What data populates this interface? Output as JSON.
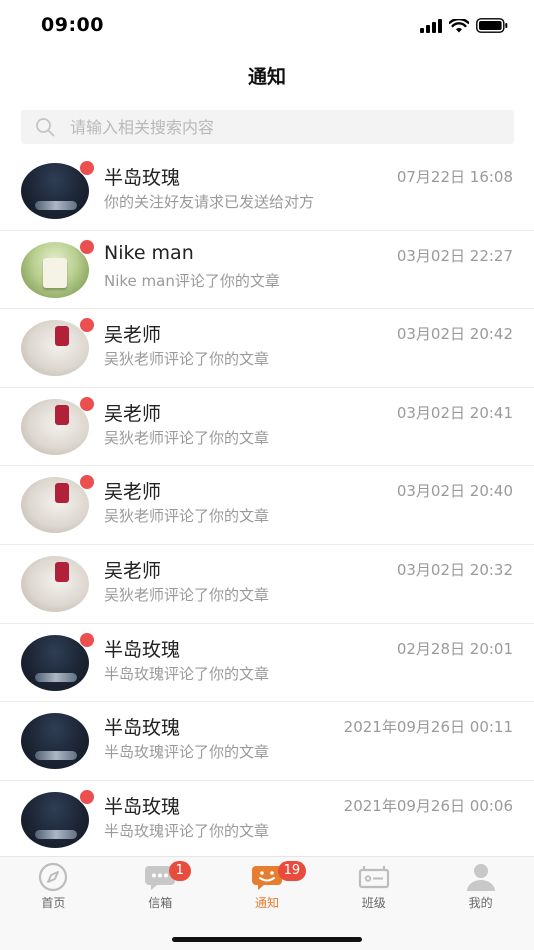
{
  "status_bar": {
    "time": "09:00",
    "icons": [
      "signal-icon",
      "wifi-icon",
      "battery-icon"
    ]
  },
  "header": {
    "title": "通知"
  },
  "search": {
    "placeholder": "请输入相关搜索内容"
  },
  "colors": {
    "accent": "#e67e30",
    "badge": "#e84c3d",
    "unread_dot": "#ec4f4f"
  },
  "notifications": [
    {
      "name": "半岛玫瑰",
      "time": "07月22日 16:08",
      "message": "你的关注好友请求已发送给对方",
      "unread": true,
      "avatar": "night"
    },
    {
      "name": "Nike man",
      "time": "03月02日 22:27",
      "message": "Nike man评论了你的文章",
      "unread": true,
      "avatar": "green"
    },
    {
      "name": "吴老师",
      "time": "03月02日 20:42",
      "message": "吴狄老师评论了你的文章",
      "unread": true,
      "avatar": "flower"
    },
    {
      "name": "吴老师",
      "time": "03月02日 20:41",
      "message": "吴狄老师评论了你的文章",
      "unread": true,
      "avatar": "flower"
    },
    {
      "name": "吴老师",
      "time": "03月02日 20:40",
      "message": "吴狄老师评论了你的文章",
      "unread": true,
      "avatar": "flower"
    },
    {
      "name": "吴老师",
      "time": "03月02日 20:32",
      "message": "吴狄老师评论了你的文章",
      "unread": false,
      "avatar": "flower"
    },
    {
      "name": "半岛玫瑰",
      "time": "02月28日 20:01",
      "message": "半岛玫瑰评论了你的文章",
      "unread": true,
      "avatar": "night"
    },
    {
      "name": "半岛玫瑰",
      "time": "2021年09月26日 00:11",
      "message": "半岛玫瑰评论了你的文章",
      "unread": false,
      "avatar": "night"
    },
    {
      "name": "半岛玫瑰",
      "time": "2021年09月26日 00:06",
      "message": "半岛玫瑰评论了你的文章",
      "unread": true,
      "avatar": "night"
    }
  ],
  "tabbar": {
    "tabs": [
      {
        "label": "首页",
        "icon": "compass-icon",
        "badge": ""
      },
      {
        "label": "信箱",
        "icon": "chat-bubble-icon",
        "badge": "1"
      },
      {
        "label": "通知",
        "icon": "notification-bubble-icon",
        "badge": "19",
        "active": true
      },
      {
        "label": "班级",
        "icon": "class-card-icon",
        "badge": ""
      },
      {
        "label": "我的",
        "icon": "person-icon",
        "badge": ""
      }
    ]
  }
}
